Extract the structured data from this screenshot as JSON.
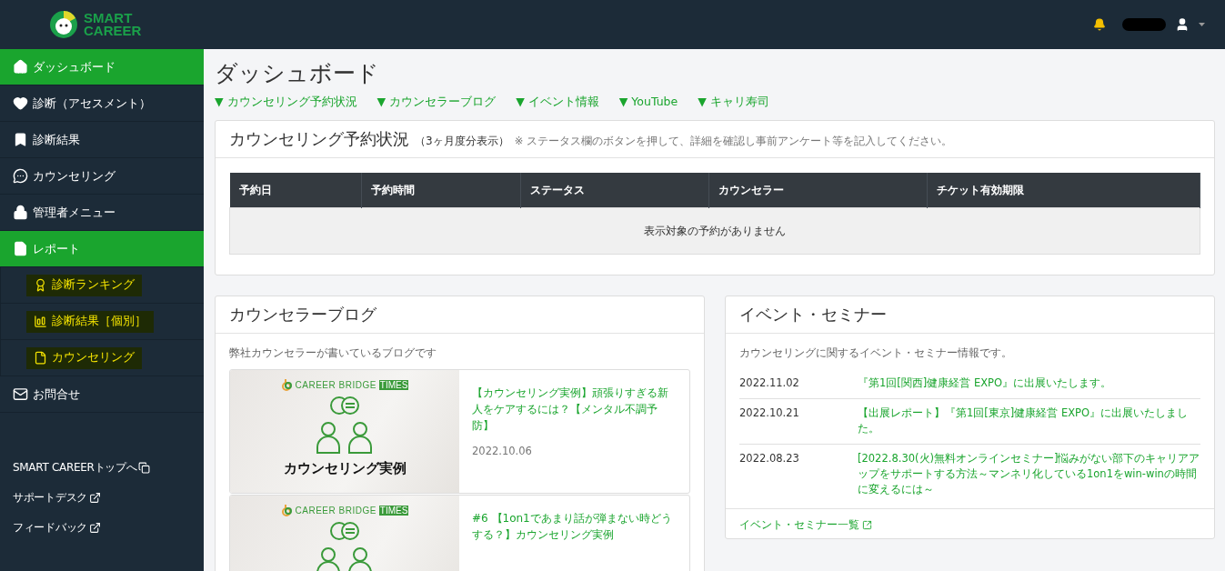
{
  "header": {
    "logo_line1": "SMART",
    "logo_line2": "CAREER"
  },
  "sidebar": {
    "items": [
      {
        "label": "ダッシュボード",
        "selected": true
      },
      {
        "label": "診断（アセスメント）",
        "selected": false
      },
      {
        "label": "診断結果",
        "selected": false
      },
      {
        "label": "カウンセリング",
        "selected": false
      },
      {
        "label": "管理者メニュー",
        "selected": false
      },
      {
        "label": "レポート",
        "selected": true,
        "children": [
          {
            "label": "診断ランキング"
          },
          {
            "label": "診断結果［個別］"
          },
          {
            "label": "カウンセリング"
          }
        ]
      },
      {
        "label": "お問合せ",
        "selected": false
      }
    ],
    "links": [
      {
        "label": "SMART CAREERトップへ",
        "kind": "copy"
      },
      {
        "label": "サポートデスク",
        "kind": "external"
      },
      {
        "label": "フィードバック",
        "kind": "external"
      }
    ]
  },
  "page": {
    "title": "ダッシュボード",
    "anchors": [
      "▼ カウンセリング予約状況",
      "▼ カウンセラーブログ",
      "▼ イベント情報",
      "▼ YouTube",
      "▼ キャリ寿司"
    ]
  },
  "reservations": {
    "title": "カウンセリング予約状況",
    "subtitle": "（3ヶ月度分表示）",
    "note": "※ ステータス欄のボタンを押して、詳細を確認し事前アンケート等を記入してください。",
    "table": {
      "columns": [
        "予約日",
        "予約時間",
        "ステータス",
        "カウンセラー",
        "チケット有効期限"
      ],
      "empty": "表示対象の予約がありません"
    }
  },
  "blog": {
    "title": "カウンセラーブログ",
    "description": "弊社カウンセラーが書いているブログです",
    "posts": [
      {
        "brand": "CAREER BRIDGE",
        "brand_tag": "TIMES",
        "caption": "カウンセリング実例",
        "title": "【カウンセリング実例】頑張りすぎる新人をケアするには？【メンタル不調予防】",
        "date": "2022.10.06"
      },
      {
        "brand": "CAREER BRIDGE",
        "brand_tag": "TIMES",
        "title": "#6 【1on1であまり話が弾まない時どうする？】カウンセリング実例"
      }
    ]
  },
  "events": {
    "title": "イベント・セミナー",
    "description": "カウンセリングに関するイベント・セミナー情報です。",
    "items": [
      {
        "date": "2022.11.02",
        "title": "『第1回[関西]健康経営 EXPO』に出展いたします。"
      },
      {
        "date": "2022.10.21",
        "title": "【出展レポート】『第1回[東京]健康経営 EXPO』に出展いたしました。"
      },
      {
        "date": "2022.08.23",
        "title": "[2022.8.30(火)無料オンラインセミナー]悩みがない部下のキャリアアップをサポートする方法～マンネリ化している1on1をwin-winの時間に変えるには～"
      }
    ],
    "more": "イベント・セミナー一覧"
  }
}
